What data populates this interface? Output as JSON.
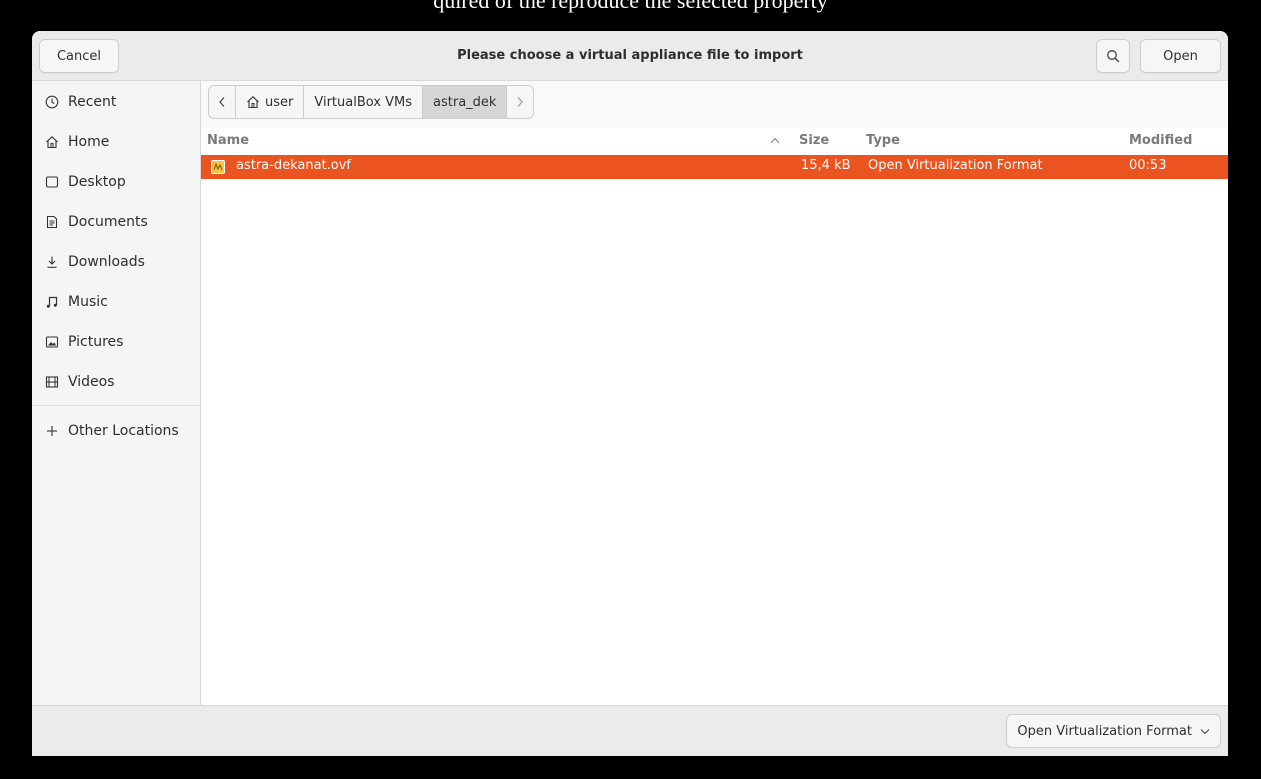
{
  "background_text": "quired of the reproduce the selected property",
  "dialog": {
    "title": "Please choose a virtual appliance file to import",
    "cancel_label": "Cancel",
    "open_label": "Open",
    "search_icon": "search-icon"
  },
  "sidebar": {
    "items": [
      {
        "label": "Recent",
        "icon": "clock-icon"
      },
      {
        "label": "Home",
        "icon": "home-icon"
      },
      {
        "label": "Desktop",
        "icon": "desktop-icon"
      },
      {
        "label": "Documents",
        "icon": "document-icon"
      },
      {
        "label": "Downloads",
        "icon": "download-icon"
      },
      {
        "label": "Music",
        "icon": "music-icon"
      },
      {
        "label": "Pictures",
        "icon": "picture-icon"
      },
      {
        "label": "Videos",
        "icon": "video-icon"
      }
    ],
    "other_locations": "Other Locations"
  },
  "pathbar": {
    "crumbs": [
      "user",
      "VirtualBox VMs",
      "astra_dek"
    ]
  },
  "columns": {
    "name": "Name",
    "size": "Size",
    "type": "Type",
    "modified": "Modified"
  },
  "files": [
    {
      "name": "astra-dekanat.ovf",
      "size": "15,4 kB",
      "type": "Open Virtualization Format",
      "modified": "00:53"
    }
  ],
  "footer": {
    "filter_label": "Open Virtualization Format"
  },
  "colors": {
    "selection": "#e95420",
    "header_bg": "#ebebeb"
  }
}
